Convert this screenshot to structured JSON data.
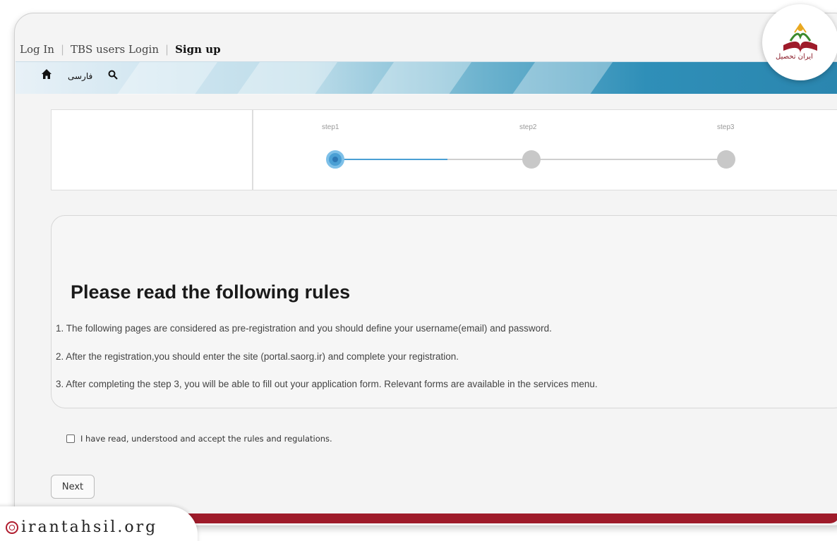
{
  "topnav": {
    "items": [
      "Log In",
      "TBS users Login",
      "Sign up"
    ],
    "active": "Sign up"
  },
  "toolbar": {
    "home_icon": "home-icon",
    "language_label": "فارسی",
    "search_icon": "search-icon"
  },
  "logo": {
    "text": "ایران تحصیل",
    "brand_color": "#9e1b2a"
  },
  "stepper": {
    "steps": [
      "step1",
      "step2",
      "step3"
    ],
    "current_step": 1,
    "accent_color": "#4a9fd4"
  },
  "rules": {
    "title": "Please read the following rules",
    "items": [
      "1. The following pages are considered as pre-registration and you should define your username(email) and password.",
      "2. After the registration,you should enter the site (portal.saorg.ir) and complete your registration.",
      "3. After completing the step 3, you will be able to fill out your application form. Relevant forms are available in the services menu."
    ]
  },
  "agreement": {
    "label": "I have read, understood and accept the rules and regulations.",
    "checked": false
  },
  "next_button": {
    "label": "Next"
  },
  "watermark": {
    "site": "irantahsil.org"
  }
}
